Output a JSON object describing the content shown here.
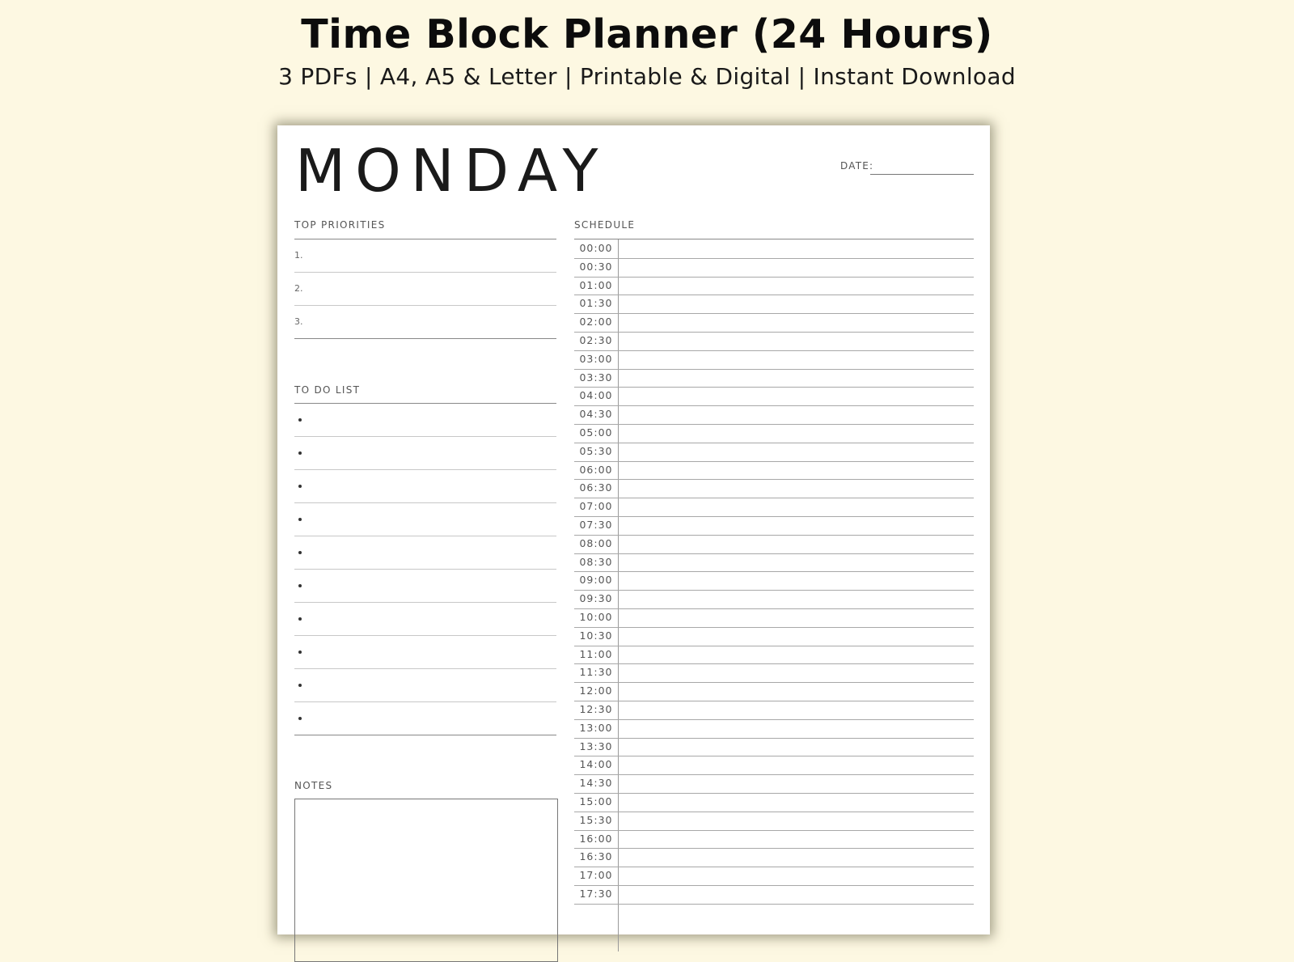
{
  "header": {
    "title": "Time Block Planner (24 Hours)",
    "subtitle": "3 PDFs | A4, A5 & Letter | Printable & Digital | Instant Download"
  },
  "planner": {
    "day": "MONDAY",
    "date_label": "DATE:",
    "priorities": {
      "label": "TOP PRIORITIES",
      "items": [
        "1.",
        "2.",
        "3."
      ]
    },
    "todo": {
      "label": "TO DO LIST",
      "count": 10
    },
    "notes": {
      "label": "NOTES"
    },
    "schedule": {
      "label": "SCHEDULE",
      "times": [
        "00:00",
        "00:30",
        "01:00",
        "01:30",
        "02:00",
        "02:30",
        "03:00",
        "03:30",
        "04:00",
        "04:30",
        "05:00",
        "05:30",
        "06:00",
        "06:30",
        "07:00",
        "07:30",
        "08:00",
        "08:30",
        "09:00",
        "09:30",
        "10:00",
        "10:30",
        "11:00",
        "11:30",
        "12:00",
        "12:30",
        "13:00",
        "13:30",
        "14:00",
        "14:30",
        "15:00",
        "15:30",
        "16:00",
        "16:30",
        "17:00",
        "17:30"
      ]
    }
  },
  "colors": {
    "background": "#fdf8e2",
    "paper": "#ffffff",
    "text": "#1a1a1a"
  }
}
